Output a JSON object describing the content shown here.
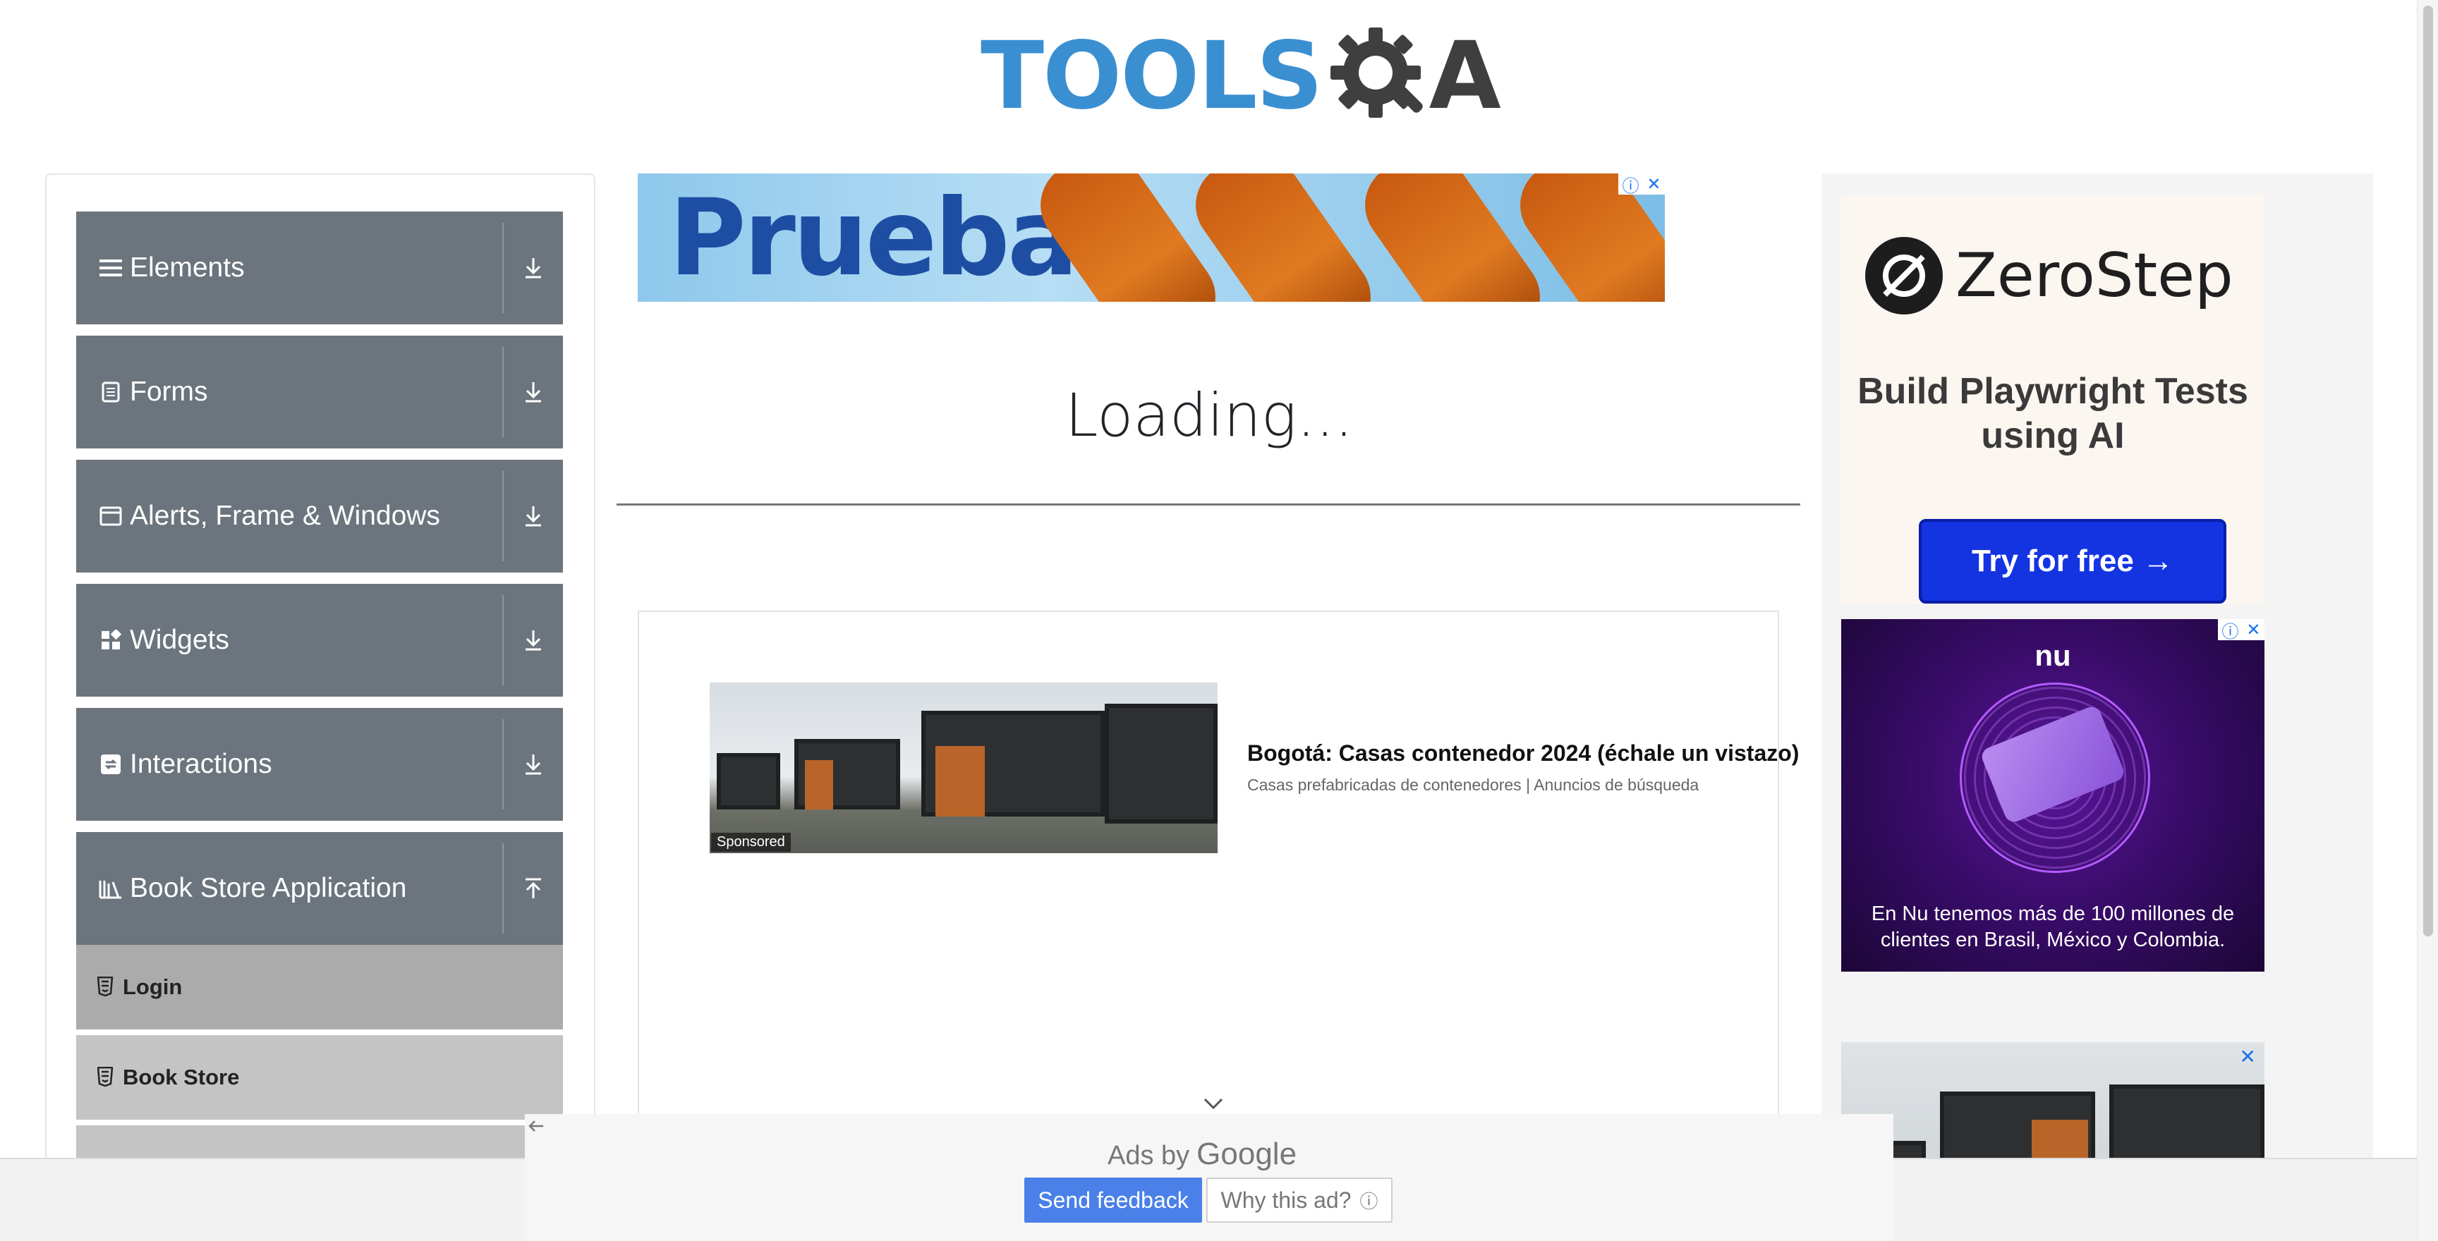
{
  "header": {
    "logo_text_tools": "TOOLS",
    "logo_text_a": "A",
    "brand_colors": {
      "tools": "#3a8fd1",
      "qa": "#3f3f3f"
    }
  },
  "sidebar": {
    "groups": [
      {
        "label": "Elements",
        "icon": "hamburger-icon",
        "toggle_icon": "download-arrow-icon"
      },
      {
        "label": "Forms",
        "icon": "document-icon",
        "toggle_icon": "download-arrow-icon"
      },
      {
        "label": "Alerts, Frame & Windows",
        "icon": "window-icon",
        "toggle_icon": "download-arrow-icon"
      },
      {
        "label": "Widgets",
        "icon": "widgets-icon",
        "toggle_icon": "download-arrow-icon"
      },
      {
        "label": "Interactions",
        "icon": "interactions-icon",
        "toggle_icon": "download-arrow-icon"
      },
      {
        "label": "Book Store Application",
        "icon": "library-icon",
        "toggle_icon": "upload-arrow-icon",
        "expanded": true
      }
    ],
    "subitems": [
      {
        "label": "Login",
        "icon": "html5-icon",
        "active": true
      },
      {
        "label": "Book Store",
        "icon": "html5-icon",
        "active": false
      }
    ],
    "group_color": "#6c757d"
  },
  "main": {
    "banner_ad": {
      "headline": "Prueba"
    },
    "loading_text": "Loading...",
    "sponsored_ad": {
      "badge": "Sponsored",
      "title": "Bogotá: Casas contenedor 2024 (échale un vistazo)",
      "subtitle": "Casas prefabricadas de contenedores | Anuncios de búsqueda"
    }
  },
  "right_ads": {
    "zerostep": {
      "brand": "ZeroStep",
      "headline": "Build Playwright Tests using AI",
      "cta": "Try for free →",
      "cta_color": "#1434e2"
    },
    "nu": {
      "brand": "nu",
      "text": "En Nu tenemos más de 100 millones de clientes en Brasil, México y Colombia."
    }
  },
  "ad_footer": {
    "ads_by": "Ads by",
    "google": "Google",
    "send_feedback": "Send feedback",
    "why_this_ad": "Why this ad?",
    "info_glyph": "ⓘ"
  }
}
